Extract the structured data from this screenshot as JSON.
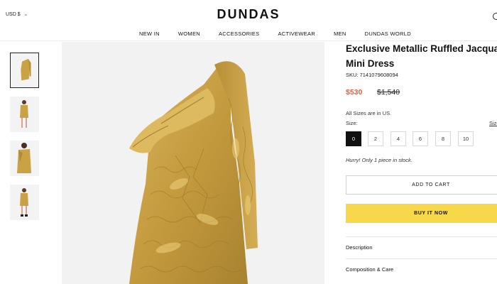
{
  "header": {
    "currency": "USD $",
    "logo": "DUNDAS",
    "nav": [
      "NEW IN",
      "WOMEN",
      "ACCESSORIES",
      "ACTIVEWEAR",
      "MEN",
      "DUNDAS WORLD"
    ]
  },
  "product": {
    "title_line1": "Exclusive Metallic Ruffled Jacquard",
    "title_line2": "Mini Dress",
    "sku": "SKU: 7141079608094",
    "price": "$530",
    "compare_price": "$1,540",
    "sizes_note": "All Sizes are in US.",
    "size_label": "Size:",
    "size_guide": "Size Guide",
    "sizes": [
      "0",
      "2",
      "4",
      "6",
      "8",
      "10"
    ],
    "selected_size": "0",
    "stock_note": "Hurry! Only 1 piece in stock.",
    "add_to_cart": "ADD TO CART",
    "buy_now": "BUY IT NOW",
    "accordions": [
      "Description",
      "Composition & Care"
    ]
  },
  "colors": {
    "price": "#e0603f",
    "buy_button": "#f7d84a",
    "dress_gold": "#c9a246"
  }
}
